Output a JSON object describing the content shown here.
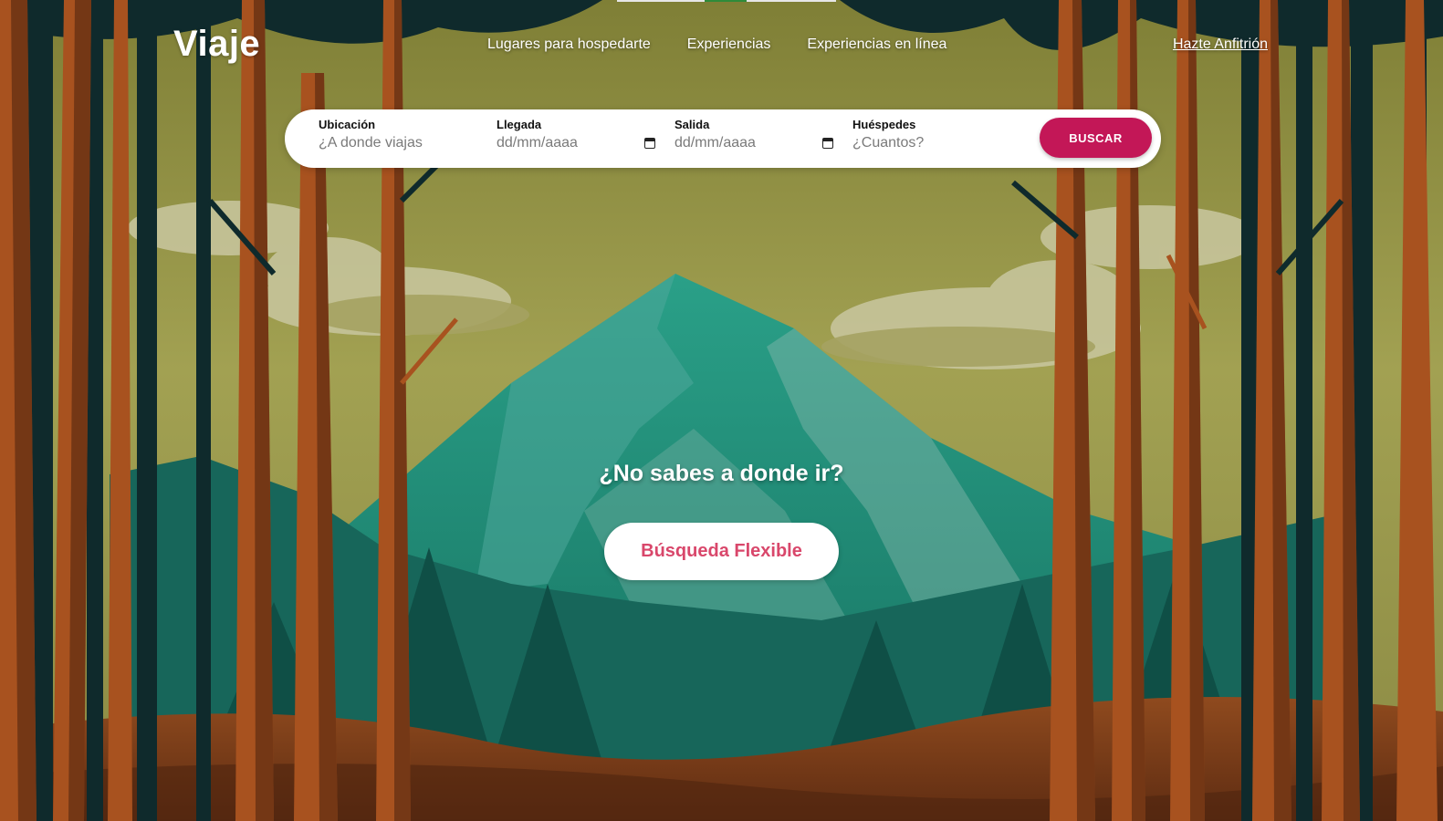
{
  "brand": {
    "logo_text": "Viaje"
  },
  "nav": {
    "items": [
      {
        "label": "Lugares para hospedarte"
      },
      {
        "label": "Experiencias"
      },
      {
        "label": "Experiencias en línea"
      }
    ],
    "host_link": "Hazte Anfitrión"
  },
  "search": {
    "location": {
      "label": "Ubicación",
      "placeholder": "¿A donde viajas"
    },
    "checkin": {
      "label": "Llegada",
      "placeholder": "dd/mm/aaaa",
      "icon": "calendar-icon"
    },
    "checkout": {
      "label": "Salida",
      "placeholder": "dd/mm/aaaa",
      "icon": "calendar-icon"
    },
    "guests": {
      "label": "Huéspedes",
      "placeholder": "¿Cuantos?"
    },
    "button_label": "BUSCAR"
  },
  "hero": {
    "question": "¿No sabes a donde ir?",
    "flexible_button": "Búsqueda Flexible"
  },
  "colors": {
    "accent": "#c31757",
    "flexible_text": "#d9476b",
    "sky": "#8e8e3e",
    "mountain": "#1f8a78",
    "forest_dark": "#0f2a2c",
    "trunk": "#a8521f",
    "ground": "#7a3d19"
  }
}
